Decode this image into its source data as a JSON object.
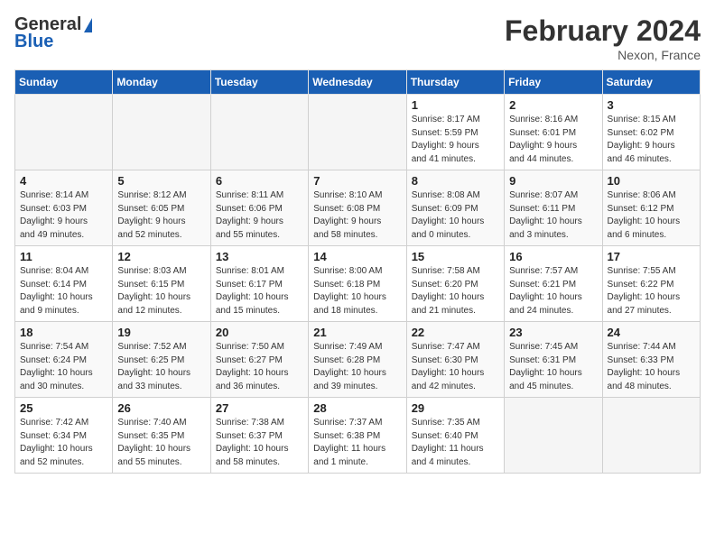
{
  "header": {
    "logo_general": "General",
    "logo_blue": "Blue",
    "month": "February 2024",
    "location": "Nexon, France"
  },
  "columns": [
    "Sunday",
    "Monday",
    "Tuesday",
    "Wednesday",
    "Thursday",
    "Friday",
    "Saturday"
  ],
  "weeks": [
    [
      {
        "day": "",
        "info": ""
      },
      {
        "day": "",
        "info": ""
      },
      {
        "day": "",
        "info": ""
      },
      {
        "day": "",
        "info": ""
      },
      {
        "day": "1",
        "info": "Sunrise: 8:17 AM\nSunset: 5:59 PM\nDaylight: 9 hours\nand 41 minutes."
      },
      {
        "day": "2",
        "info": "Sunrise: 8:16 AM\nSunset: 6:01 PM\nDaylight: 9 hours\nand 44 minutes."
      },
      {
        "day": "3",
        "info": "Sunrise: 8:15 AM\nSunset: 6:02 PM\nDaylight: 9 hours\nand 46 minutes."
      }
    ],
    [
      {
        "day": "4",
        "info": "Sunrise: 8:14 AM\nSunset: 6:03 PM\nDaylight: 9 hours\nand 49 minutes."
      },
      {
        "day": "5",
        "info": "Sunrise: 8:12 AM\nSunset: 6:05 PM\nDaylight: 9 hours\nand 52 minutes."
      },
      {
        "day": "6",
        "info": "Sunrise: 8:11 AM\nSunset: 6:06 PM\nDaylight: 9 hours\nand 55 minutes."
      },
      {
        "day": "7",
        "info": "Sunrise: 8:10 AM\nSunset: 6:08 PM\nDaylight: 9 hours\nand 58 minutes."
      },
      {
        "day": "8",
        "info": "Sunrise: 8:08 AM\nSunset: 6:09 PM\nDaylight: 10 hours\nand 0 minutes."
      },
      {
        "day": "9",
        "info": "Sunrise: 8:07 AM\nSunset: 6:11 PM\nDaylight: 10 hours\nand 3 minutes."
      },
      {
        "day": "10",
        "info": "Sunrise: 8:06 AM\nSunset: 6:12 PM\nDaylight: 10 hours\nand 6 minutes."
      }
    ],
    [
      {
        "day": "11",
        "info": "Sunrise: 8:04 AM\nSunset: 6:14 PM\nDaylight: 10 hours\nand 9 minutes."
      },
      {
        "day": "12",
        "info": "Sunrise: 8:03 AM\nSunset: 6:15 PM\nDaylight: 10 hours\nand 12 minutes."
      },
      {
        "day": "13",
        "info": "Sunrise: 8:01 AM\nSunset: 6:17 PM\nDaylight: 10 hours\nand 15 minutes."
      },
      {
        "day": "14",
        "info": "Sunrise: 8:00 AM\nSunset: 6:18 PM\nDaylight: 10 hours\nand 18 minutes."
      },
      {
        "day": "15",
        "info": "Sunrise: 7:58 AM\nSunset: 6:20 PM\nDaylight: 10 hours\nand 21 minutes."
      },
      {
        "day": "16",
        "info": "Sunrise: 7:57 AM\nSunset: 6:21 PM\nDaylight: 10 hours\nand 24 minutes."
      },
      {
        "day": "17",
        "info": "Sunrise: 7:55 AM\nSunset: 6:22 PM\nDaylight: 10 hours\nand 27 minutes."
      }
    ],
    [
      {
        "day": "18",
        "info": "Sunrise: 7:54 AM\nSunset: 6:24 PM\nDaylight: 10 hours\nand 30 minutes."
      },
      {
        "day": "19",
        "info": "Sunrise: 7:52 AM\nSunset: 6:25 PM\nDaylight: 10 hours\nand 33 minutes."
      },
      {
        "day": "20",
        "info": "Sunrise: 7:50 AM\nSunset: 6:27 PM\nDaylight: 10 hours\nand 36 minutes."
      },
      {
        "day": "21",
        "info": "Sunrise: 7:49 AM\nSunset: 6:28 PM\nDaylight: 10 hours\nand 39 minutes."
      },
      {
        "day": "22",
        "info": "Sunrise: 7:47 AM\nSunset: 6:30 PM\nDaylight: 10 hours\nand 42 minutes."
      },
      {
        "day": "23",
        "info": "Sunrise: 7:45 AM\nSunset: 6:31 PM\nDaylight: 10 hours\nand 45 minutes."
      },
      {
        "day": "24",
        "info": "Sunrise: 7:44 AM\nSunset: 6:33 PM\nDaylight: 10 hours\nand 48 minutes."
      }
    ],
    [
      {
        "day": "25",
        "info": "Sunrise: 7:42 AM\nSunset: 6:34 PM\nDaylight: 10 hours\nand 52 minutes."
      },
      {
        "day": "26",
        "info": "Sunrise: 7:40 AM\nSunset: 6:35 PM\nDaylight: 10 hours\nand 55 minutes."
      },
      {
        "day": "27",
        "info": "Sunrise: 7:38 AM\nSunset: 6:37 PM\nDaylight: 10 hours\nand 58 minutes."
      },
      {
        "day": "28",
        "info": "Sunrise: 7:37 AM\nSunset: 6:38 PM\nDaylight: 11 hours\nand 1 minute."
      },
      {
        "day": "29",
        "info": "Sunrise: 7:35 AM\nSunset: 6:40 PM\nDaylight: 11 hours\nand 4 minutes."
      },
      {
        "day": "",
        "info": ""
      },
      {
        "day": "",
        "info": ""
      }
    ]
  ]
}
